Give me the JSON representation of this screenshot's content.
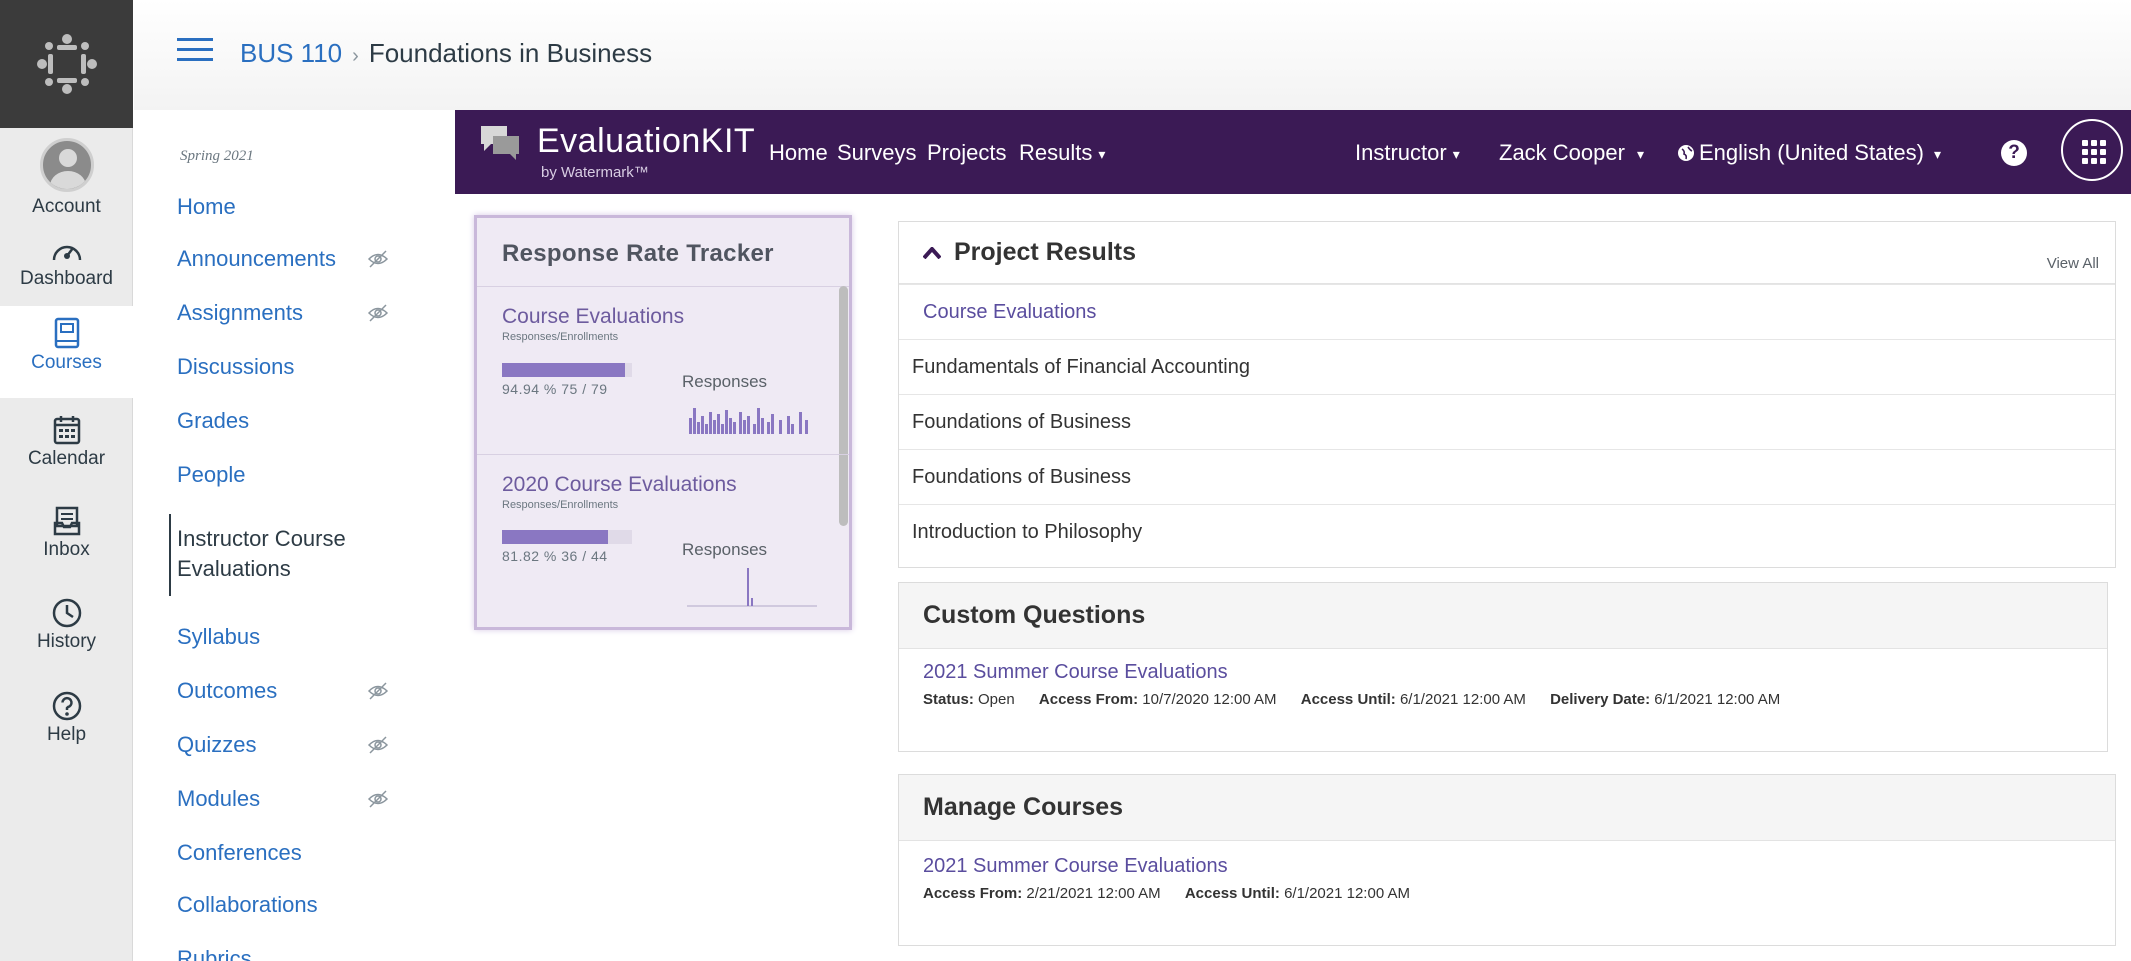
{
  "global_nav": {
    "items": [
      {
        "label": "Account",
        "icon": "account-avatar-icon"
      },
      {
        "label": "Dashboard",
        "icon": "speedometer-icon"
      },
      {
        "label": "Courses",
        "icon": "book-icon"
      },
      {
        "label": "Calendar",
        "icon": "calendar-icon"
      },
      {
        "label": "Inbox",
        "icon": "inbox-icon"
      },
      {
        "label": "History",
        "icon": "clock-icon"
      },
      {
        "label": "Help",
        "icon": "question-icon"
      }
    ],
    "active": "Courses"
  },
  "header": {
    "course_code": "BUS 110",
    "separator": "›",
    "page": "Foundations in Business"
  },
  "course_nav": {
    "term": "Spring 2021",
    "items": [
      {
        "label": "Home",
        "hidden": false
      },
      {
        "label": "Announcements",
        "hidden": true
      },
      {
        "label": "Assignments",
        "hidden": true
      },
      {
        "label": "Discussions",
        "hidden": false
      },
      {
        "label": "Grades",
        "hidden": false
      },
      {
        "label": "People",
        "hidden": false
      },
      {
        "label": "Instructor Course Evaluations",
        "hidden": false,
        "active": true
      },
      {
        "label": "Syllabus",
        "hidden": false
      },
      {
        "label": "Outcomes",
        "hidden": true
      },
      {
        "label": "Quizzes",
        "hidden": true
      },
      {
        "label": "Modules",
        "hidden": true
      },
      {
        "label": "Conferences",
        "hidden": false
      },
      {
        "label": "Collaborations",
        "hidden": false
      },
      {
        "label": "Rubrics",
        "hidden": false
      }
    ]
  },
  "ek": {
    "brand": "EvaluationKIT",
    "sub": "by Watermark™",
    "nav": {
      "home": "Home",
      "surveys": "Surveys",
      "projects": "Projects",
      "results": "Results"
    },
    "role": "Instructor",
    "user": "Zack Cooper",
    "language": "English (United States)",
    "help": "?",
    "colors": {
      "bar": "#3b1a55",
      "accent": "#8a77c2",
      "link": "#5a4d9e"
    }
  },
  "tracker": {
    "title": "Response Rate Tracker",
    "entries": [
      {
        "name": "Course Evaluations",
        "sub": "Responses/Enrollments",
        "pct_text": "94.94 % 75 / 79",
        "fill": 0.9494,
        "resp_label": "Responses"
      },
      {
        "name": "2020 Course Evaluations",
        "sub": "Responses/Enrollments",
        "pct_text": "81.82 % 36 / 44",
        "fill": 0.8182,
        "resp_label": "Responses"
      }
    ]
  },
  "project_results": {
    "title": "Project Results",
    "view_all": "View All",
    "rows": [
      "Course Evaluations",
      "Fundamentals of Financial Accounting",
      "Foundations of Business",
      "Foundations of Business",
      "Introduction to Philosophy"
    ]
  },
  "custom_questions": {
    "title": "Custom Questions",
    "link": "2021 Summer Course Evaluations",
    "status_label": "Status:",
    "status": "Open",
    "access_from_label": "Access From:",
    "access_from": "10/7/2020 12:00 AM",
    "access_until_label": "Access Until:",
    "access_until": "6/1/2021 12:00 AM",
    "delivery_label": "Delivery Date:",
    "delivery": "6/1/2021 12:00 AM"
  },
  "manage_courses": {
    "title": "Manage Courses",
    "link": "2021 Summer Course Evaluations",
    "access_from_label": "Access From:",
    "access_from": "2/21/2021 12:00 AM",
    "access_until_label": "Access Until:",
    "access_until": "6/1/2021 12:00 AM"
  }
}
